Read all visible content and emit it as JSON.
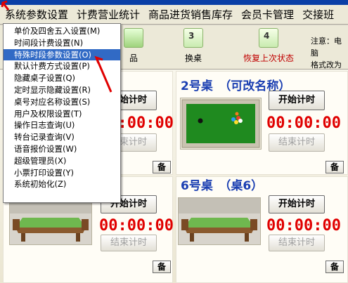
{
  "menubar": {
    "items": [
      "系统参数设置",
      "计费营业统计",
      "商品进货销售库存",
      "会员卡管理",
      "交接班"
    ]
  },
  "toolbar": {
    "buttons": [
      {
        "label": "品",
        "num": ""
      },
      {
        "label": "换桌",
        "num": "3"
      },
      {
        "label": "恢复上次状态",
        "num": "4"
      }
    ],
    "notice": [
      "注意：电脑",
      "格式改为"
    ]
  },
  "dropdown": {
    "items": [
      "单价及四舍五入设置(M)",
      "时间段计费设置(N)",
      "特殊时段参数设置(O)",
      "默认计费方式设置(P)",
      "隐藏桌子设置(Q)",
      "定时显示隐藏设置(R)",
      "桌号对应名称设置(S)",
      "用户及权限设置(T)",
      "操作日志查询(U)",
      "转台记录查询(V)",
      "语音报价设置(W)",
      "超级管理员(X)",
      "小票打印设置(Y)",
      "系统初始化(Z)"
    ],
    "highlighted_index": 2
  },
  "tables": {
    "t1": {
      "start": "开始计时",
      "timer": "00:00:00",
      "end": "结束计时",
      "memo": "备"
    },
    "t2": {
      "title": "2号桌　（可改名称）",
      "start": "开始计时",
      "timer": "00:00:00",
      "end": "结束计时",
      "memo": "备"
    },
    "t5": {
      "start": "开始计时",
      "timer": "00:00:00",
      "end": "结束计时",
      "memo": "备"
    },
    "t6": {
      "title": "6号桌　（桌6）",
      "start": "开始计时",
      "timer": "00:00:00",
      "end": "结束计时",
      "memo": "备"
    }
  },
  "colors": {
    "timer": "#e00000",
    "title": "#1b3fb2",
    "highlight": "#316ac5",
    "felt": "#1f8a1f"
  }
}
